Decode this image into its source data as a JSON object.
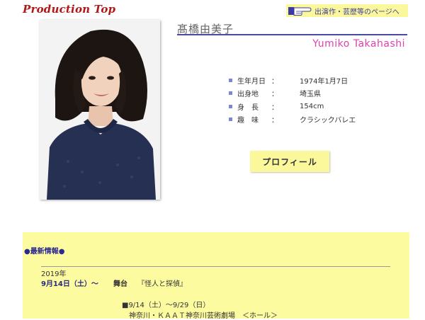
{
  "header": {
    "brand": "Production Top",
    "works_link": "出演作・芸歴等のページへ"
  },
  "profile": {
    "name_jp": "髙橋由美子",
    "name_en": "Yumiko Takahashi",
    "fields": [
      {
        "key": "生年月日",
        "value": "1974年1月7日"
      },
      {
        "key": "出身地",
        "value": "埼玉県"
      },
      {
        "key": "身　長",
        "value": "154cm"
      },
      {
        "key": "趣　味",
        "value": "クラシックバレエ"
      }
    ],
    "separator": "：",
    "button_label": "プロフィール"
  },
  "news": {
    "heading": "●最新情報●",
    "year": "2019年",
    "date": "9月14日（土）～",
    "category": "舞台",
    "title": "『怪人と探偵』",
    "period": "■9/14（土）～9/29（日）",
    "venue": "神奈川・ＫＡＡＴ神奈川芸術劇場　＜ホール＞"
  },
  "colors": {
    "brand": "#b01818",
    "accent_yellow": "#fbf89c",
    "name_en": "#e040b0",
    "rule": "#4a4aa0"
  }
}
